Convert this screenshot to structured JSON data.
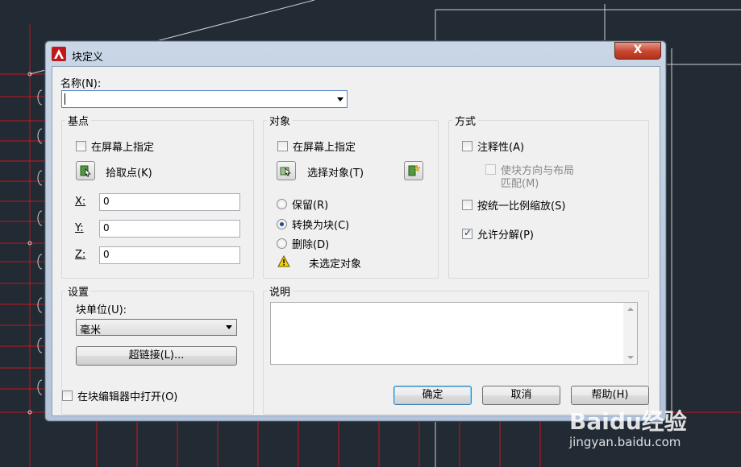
{
  "dialog": {
    "title": "块定义",
    "close_label": "X",
    "name_label": "名称(N):",
    "name_value": ""
  },
  "base_point": {
    "title": "基点",
    "specify_on_screen": "在屏幕上指定",
    "specify_checked": false,
    "pick_point_label": "拾取点(K)",
    "x_label": "X:",
    "x_value": "0",
    "y_label": "Y:",
    "y_value": "0",
    "z_label": "Z:",
    "z_value": "0"
  },
  "objects": {
    "title": "对象",
    "specify_on_screen": "在屏幕上指定",
    "specify_checked": false,
    "select_objects_label": "选择对象(T)",
    "retain_label": "保留(R)",
    "convert_label": "转换为块(C)",
    "delete_label": "删除(D)",
    "selected_option": "convert",
    "warning_text": "未选定对象"
  },
  "behavior": {
    "title": "方式",
    "annotative_label": "注释性(A)",
    "annotative_checked": false,
    "match_orientation_line1": "使块方向与布局",
    "match_orientation_line2": "匹配(M)",
    "match_orientation_checked": false,
    "scale_uniformly_label": "按统一比例缩放(S)",
    "scale_uniformly_checked": false,
    "allow_explode_label": "允许分解(P)",
    "allow_explode_checked": true
  },
  "settings": {
    "title": "设置",
    "block_unit_label": "块单位(U):",
    "block_unit_value": "毫米",
    "hyperlink_label": "超链接(L)..."
  },
  "description": {
    "title": "说明",
    "value": ""
  },
  "footer": {
    "open_in_editor_label": "在块编辑器中打开(O)",
    "open_in_editor_checked": false,
    "ok_label": "确定",
    "cancel_label": "取消",
    "help_label": "帮助(H)"
  },
  "watermark": {
    "logo_text": "Baidu经验",
    "url_text": "jingyan.baidu.com"
  },
  "colors": {
    "cad_background": "#222a34",
    "cad_red_line": "#c8161d",
    "cad_white_line": "#d0d0d0",
    "title_close": "#c8452f"
  }
}
